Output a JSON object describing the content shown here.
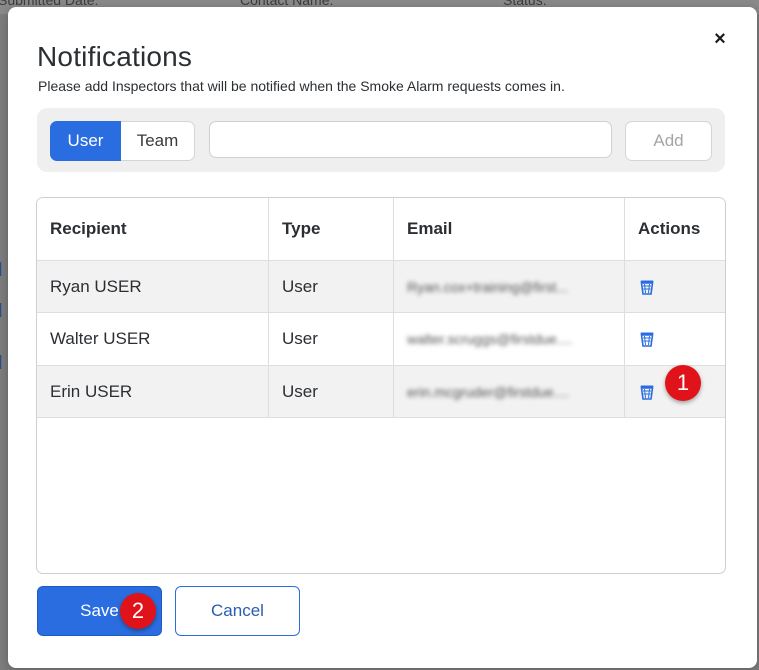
{
  "background": {
    "columns": [
      "Submitted Date:",
      "Contact Name:",
      "Status:"
    ]
  },
  "modal": {
    "title": "Notifications",
    "subtitle": "Please add Inspectors that will be notified when the Smoke Alarm requests comes in.",
    "close_icon": "close-icon",
    "close_glyph": "×"
  },
  "add_bar": {
    "segments": [
      {
        "label": "User",
        "selected": true
      },
      {
        "label": "Team",
        "selected": false
      }
    ],
    "input_value": "",
    "input_placeholder": "",
    "add_label": "Add"
  },
  "table": {
    "headers": [
      "Recipient",
      "Type",
      "Email",
      "Actions"
    ],
    "rows": [
      {
        "recipient": "Ryan USER",
        "type": "User",
        "email": "Ryan.cox+training@first...",
        "action_icon": "trash-icon"
      },
      {
        "recipient": "Walter USER",
        "type": "User",
        "email": "walter.scruggs@firstdue....",
        "action_icon": "trash-icon"
      },
      {
        "recipient": "Erin USER",
        "type": "User",
        "email": "erin.mcgruder@firstdue....",
        "action_icon": "trash-icon"
      }
    ]
  },
  "footer": {
    "save_label": "Save",
    "cancel_label": "Cancel"
  },
  "annotations": {
    "step1": "1",
    "step2": "2"
  },
  "colors": {
    "primary": "#2a6de0",
    "badge": "#e0131a",
    "trash_icon": "#2a6de0"
  }
}
